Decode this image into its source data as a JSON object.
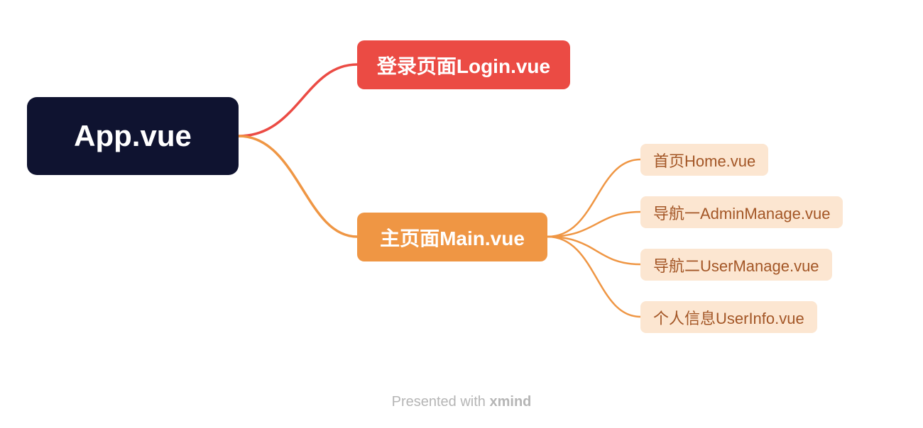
{
  "root": {
    "label": "App.vue"
  },
  "children": [
    {
      "id": "login",
      "label": "登录页面Login.vue",
      "color": "#eb4b44"
    },
    {
      "id": "main",
      "label": "主页面Main.vue",
      "color": "#ef9644",
      "children": [
        {
          "id": "home",
          "label": "首页Home.vue"
        },
        {
          "id": "admin",
          "label": "导航一AdminManage.vue"
        },
        {
          "id": "user",
          "label": "导航二UserManage.vue"
        },
        {
          "id": "info",
          "label": "个人信息UserInfo.vue"
        }
      ]
    }
  ],
  "footer": {
    "prefix": "Presented with ",
    "brand": "xmind"
  }
}
